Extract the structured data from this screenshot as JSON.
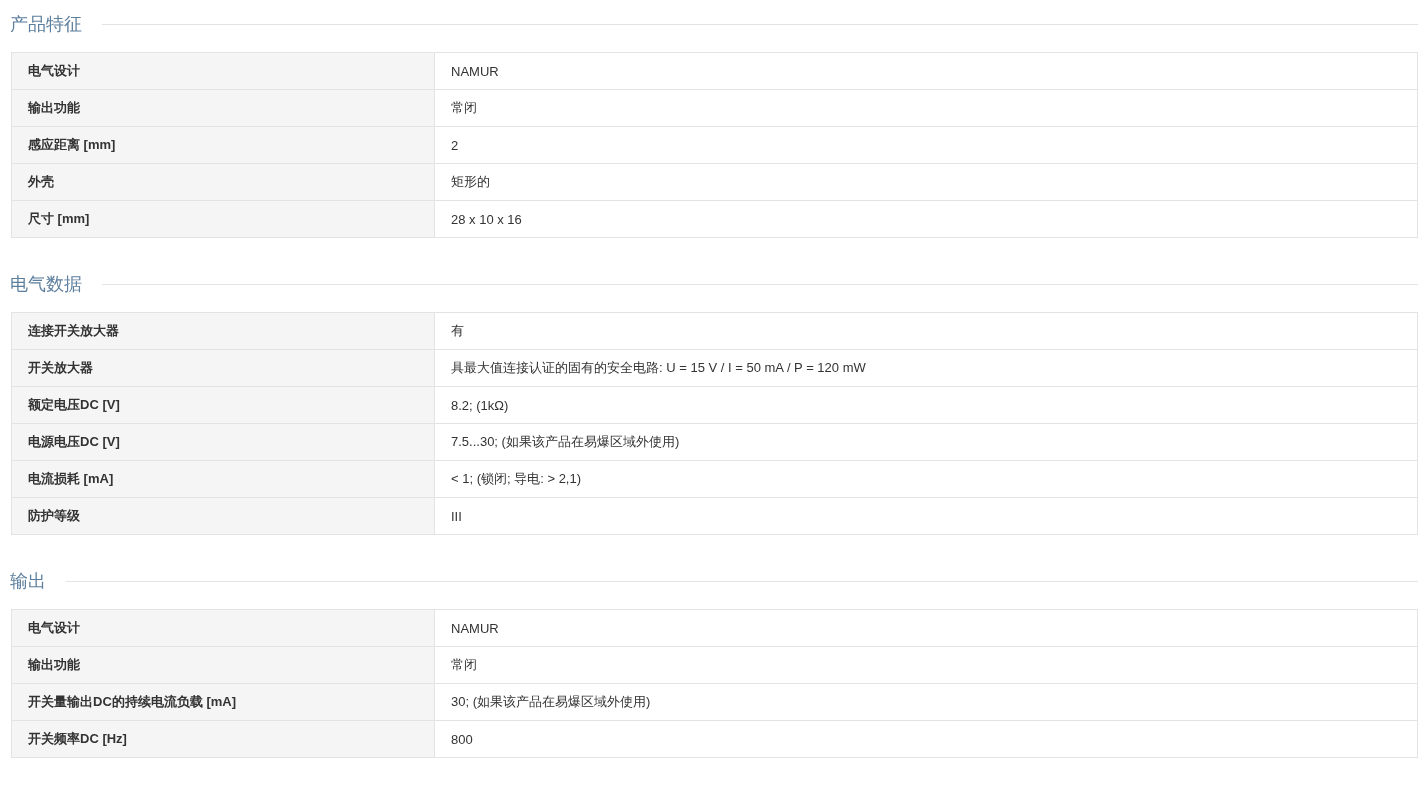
{
  "sections": [
    {
      "title": "产品特征",
      "rows": [
        {
          "label": "电气设计",
          "value": "NAMUR"
        },
        {
          "label": "输出功能",
          "value": "常闭"
        },
        {
          "label": "感应距离 [mm]",
          "value": "2"
        },
        {
          "label": "外壳",
          "value": "矩形的"
        },
        {
          "label": "尺寸 [mm]",
          "value": "28 x 10 x 16"
        }
      ]
    },
    {
      "title": "电气数据",
      "rows": [
        {
          "label": "连接开关放大器",
          "value": "有"
        },
        {
          "label": "开关放大器",
          "value": "具最大值连接认证的固有的安全电路: U = 15 V / I = 50 mA / P = 120 mW"
        },
        {
          "label": "额定电压DC [V]",
          "value": "8.2; (1kΩ)"
        },
        {
          "label": "电源电压DC [V]",
          "value": "7.5...30; (如果该产品在易爆区域外使用)"
        },
        {
          "label": "电流损耗 [mA]",
          "value": "< 1; (锁闭; 导电: > 2,1)"
        },
        {
          "label": "防护等级",
          "value": "III"
        }
      ]
    },
    {
      "title": "输出",
      "rows": [
        {
          "label": "电气设计",
          "value": "NAMUR"
        },
        {
          "label": "输出功能",
          "value": "常闭"
        },
        {
          "label": "开关量输出DC的持续电流负载 [mA]",
          "value": "30; (如果该产品在易爆区域外使用)"
        },
        {
          "label": "开关频率DC [Hz]",
          "value": "800"
        }
      ]
    }
  ]
}
